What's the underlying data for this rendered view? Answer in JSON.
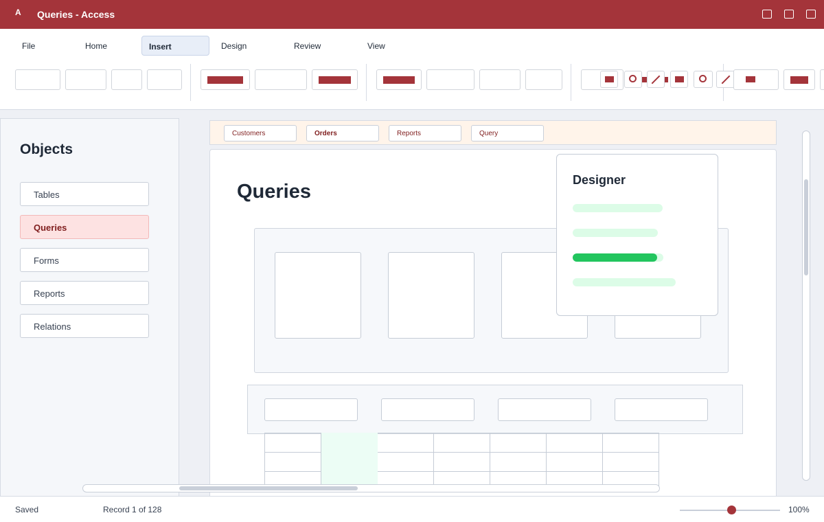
{
  "app": {
    "icon_letter": "A",
    "title": "Queries - Access",
    "accent_color": "#a4343a"
  },
  "menu": {
    "tabs": [
      "File",
      "Home",
      "Insert",
      "Design",
      "Review",
      "View"
    ],
    "active_tab": "Insert"
  },
  "objects": {
    "heading": "Objects",
    "items": [
      "Tables",
      "Queries",
      "Forms",
      "Reports",
      "Relations"
    ],
    "active": "Queries"
  },
  "doc_tabs": {
    "tabs": [
      "Customers",
      "Orders",
      "Reports",
      "Query"
    ],
    "active": "Orders"
  },
  "page": {
    "title": "Queries"
  },
  "designer": {
    "title": "Designer",
    "progress": [
      {
        "value": 0,
        "color": "#22c55e"
      },
      {
        "value": 0,
        "color": "#22c55e"
      },
      {
        "value": 0.93,
        "color": "#22c55e"
      },
      {
        "value": 0,
        "color": "#22c55e"
      }
    ]
  },
  "status": {
    "save_state": "Saved",
    "record": "Record 1 of 128",
    "zoom": "100%",
    "zoom_level": 0.52
  },
  "icons": [
    "window-minimize-icon",
    "window-maximize-icon",
    "window-close-icon",
    "circle-shape-icon",
    "line-shape-icon"
  ]
}
